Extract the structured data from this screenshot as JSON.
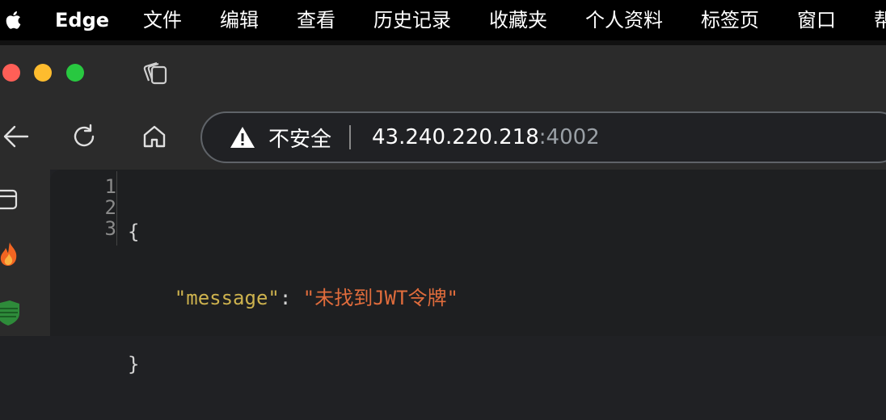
{
  "menubar": {
    "app_name": "Edge",
    "items": [
      "文件",
      "编辑",
      "查看",
      "历史记录",
      "收藏夹",
      "个人资料",
      "标签页",
      "窗口",
      "帮"
    ]
  },
  "address_bar": {
    "security_label": "不安全",
    "url_host": "43.240.220.218",
    "url_port": ":4002"
  },
  "json_viewer": {
    "line_numbers": [
      "1",
      "2",
      "3"
    ],
    "open_brace": "{",
    "key": "\"message\"",
    "colon": ": ",
    "value": "\"未找到JWT令牌\"",
    "close_brace": "}"
  },
  "colors": {
    "key": "#cdb24e",
    "string_value": "#e06c3c",
    "traffic_red": "#ff5f57",
    "traffic_yellow": "#febc2e",
    "traffic_green": "#28c840"
  },
  "icons": [
    "apple-icon",
    "tabs-icon",
    "back-arrow-icon",
    "refresh-icon",
    "home-icon",
    "warning-icon",
    "tab-icon",
    "fire-icon",
    "shield-icon"
  ]
}
